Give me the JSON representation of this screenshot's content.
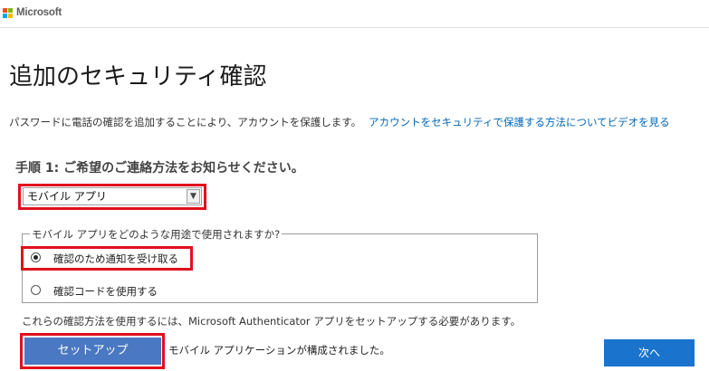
{
  "header": {
    "brand": "Microsoft",
    "logo_colors": [
      "#f25022",
      "#7fba00",
      "#00a4ef",
      "#ffb900"
    ]
  },
  "page": {
    "title": "追加のセキュリティ確認",
    "description": "パスワードに電話の確認を追加することにより、アカウントを保護します。",
    "video_link": "アカウントをセキュリティで保護する方法についてビデオを見る"
  },
  "step1": {
    "heading": "手順 1: ご希望のご連絡方法をお知らせください。",
    "method_select_value": "モバイル アプリ"
  },
  "usage": {
    "legend": "モバイル アプリをどのような用途で使用されますか?",
    "options": [
      {
        "label": "確認のため通知を受け取る",
        "checked": true
      },
      {
        "label": "確認コードを使用する",
        "checked": false
      }
    ]
  },
  "setup": {
    "note": "これらの確認方法を使用するには、Microsoft Authenticator アプリをセットアップする必要があります。",
    "button_label": "セットアップ",
    "status_message": "モバイル アプリケーションが構成されました。"
  },
  "footer": {
    "next_label": "次へ"
  },
  "colors": {
    "highlight": "#e0101e",
    "setup_button": "#4a78c2",
    "next_button": "#1a73cc",
    "link": "#0067b8"
  }
}
